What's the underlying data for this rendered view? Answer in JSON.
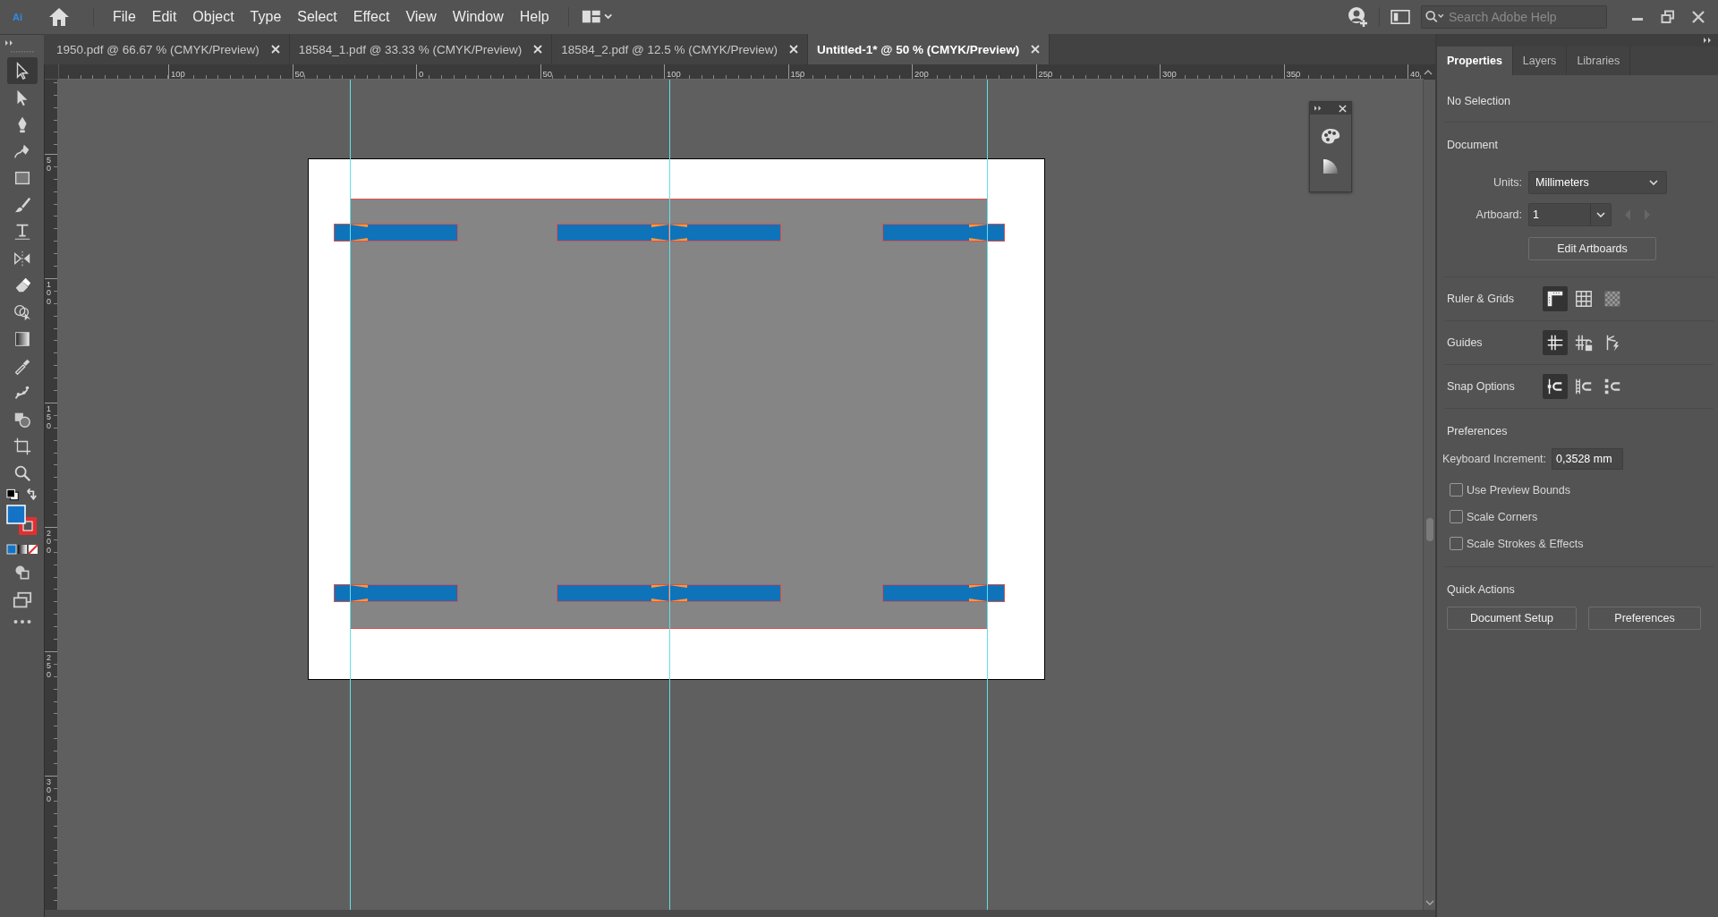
{
  "app": {
    "logo": "Ai"
  },
  "menu": [
    "File",
    "Edit",
    "Object",
    "Type",
    "Select",
    "Effect",
    "View",
    "Window",
    "Help"
  ],
  "search": {
    "placeholder": "Search Adobe Help"
  },
  "doc_tabs": [
    {
      "label": "1950.pdf @ 66.67 % (CMYK/Preview)",
      "selected": false
    },
    {
      "label": "18584_1.pdf @ 33.33 % (CMYK/Preview)",
      "selected": false
    },
    {
      "label": "18584_2.pdf @ 12.5 % (CMYK/Preview)",
      "selected": false
    },
    {
      "label": "Untitled-1* @ 50 % (CMYK/Preview)",
      "selected": true
    }
  ],
  "tools": [
    {
      "selected": true
    },
    {
      "selected": false
    },
    {
      "selected": false
    },
    {
      "selected": false
    },
    {
      "selected": false
    },
    {
      "selected": false
    },
    {
      "selected": false
    },
    {
      "selected": false
    },
    {
      "selected": false
    },
    {
      "selected": false
    },
    {
      "selected": false
    },
    {
      "selected": false
    },
    {
      "selected": false
    },
    {
      "selected": false
    },
    {
      "selected": false
    },
    {
      "selected": false
    }
  ],
  "rulers": {
    "horizontal": [
      "100",
      "50",
      "0",
      "50",
      "100",
      "150",
      "200",
      "250",
      "300",
      "350",
      "40"
    ],
    "vertical": [
      "50",
      "100",
      "150",
      "200",
      "250",
      "300"
    ]
  },
  "panel": {
    "tabs": [
      {
        "label": "Properties",
        "selected": true
      },
      {
        "label": "Layers",
        "selected": false
      },
      {
        "label": "Libraries",
        "selected": false
      }
    ],
    "status": "No Selection",
    "document": {
      "heading": "Document",
      "units_label": "Units:",
      "units_value": "Millimeters",
      "artboard_label": "Artboard:",
      "artboard_value": "1",
      "edit_button": "Edit Artboards"
    },
    "toggle_groups": [
      {
        "label": "Ruler & Grids",
        "items": [
          {
            "selected": true
          },
          {
            "selected": false
          },
          {
            "selected": false
          }
        ]
      },
      {
        "label": "Guides",
        "items": [
          {
            "selected": true
          },
          {
            "selected": false
          },
          {
            "selected": false
          }
        ]
      },
      {
        "label": "Snap Options",
        "items": [
          {
            "selected": true
          },
          {
            "selected": false
          },
          {
            "selected": false
          }
        ]
      }
    ],
    "preferences": {
      "heading": "Preferences",
      "increment_label": "Keyboard Increment:",
      "increment_value": "0,3528 mm",
      "checkboxes": [
        {
          "label": "Use Preview Bounds",
          "checked": false
        },
        {
          "label": "Scale Corners",
          "checked": false
        },
        {
          "label": "Scale Strokes & Effects",
          "checked": false
        }
      ]
    },
    "quick_actions": {
      "heading": "Quick Actions",
      "buttons": [
        "Document Setup",
        "Preferences"
      ]
    }
  }
}
